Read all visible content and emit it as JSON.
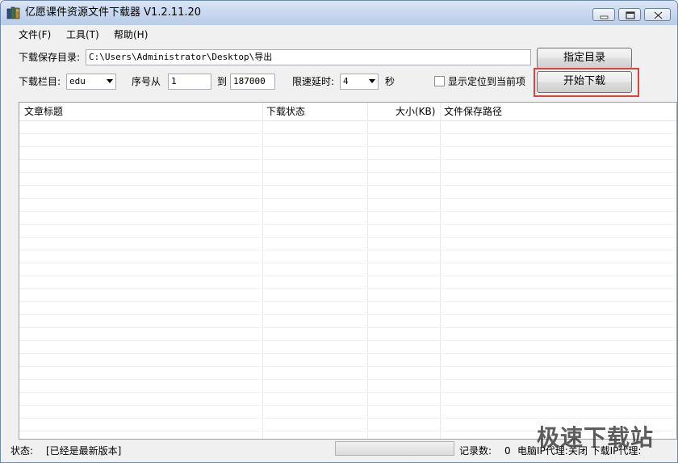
{
  "window": {
    "title": "亿愿课件资源文件下载器 V1.2.11.20"
  },
  "menu": {
    "items": [
      "文件(F)",
      "工具(T)",
      "帮助(H)"
    ]
  },
  "form": {
    "save_dir_label": "下载保存目录:",
    "save_dir_value": "C:\\Users\\Administrator\\Desktop\\导出",
    "browse_label": "指定目录",
    "category_label": "下载栏目:",
    "category_value": "edu",
    "seq_from_label": "序号从",
    "seq_from_value": "1",
    "seq_to_label": "到",
    "seq_to_value": "187000",
    "delay_label": "限速延时:",
    "delay_value": "4",
    "delay_unit": "秒",
    "locate_label": "显示定位到当前项",
    "locate_checked": false,
    "start_label": "开始下载"
  },
  "table": {
    "columns": [
      "文章标题",
      "下载状态",
      "大小(KB)",
      "文件保存路径"
    ],
    "rows": []
  },
  "status": {
    "label": "状态:",
    "value": "[已经是最新版本]",
    "progress": 0,
    "records_label": "记录数:",
    "records_value": "0",
    "info": "电脑IP代理:关闭 下载IP代理:"
  },
  "watermark": "极速下载站",
  "colors": {
    "highlight": "#e0413a",
    "titlebar": "#c7d8ee"
  }
}
